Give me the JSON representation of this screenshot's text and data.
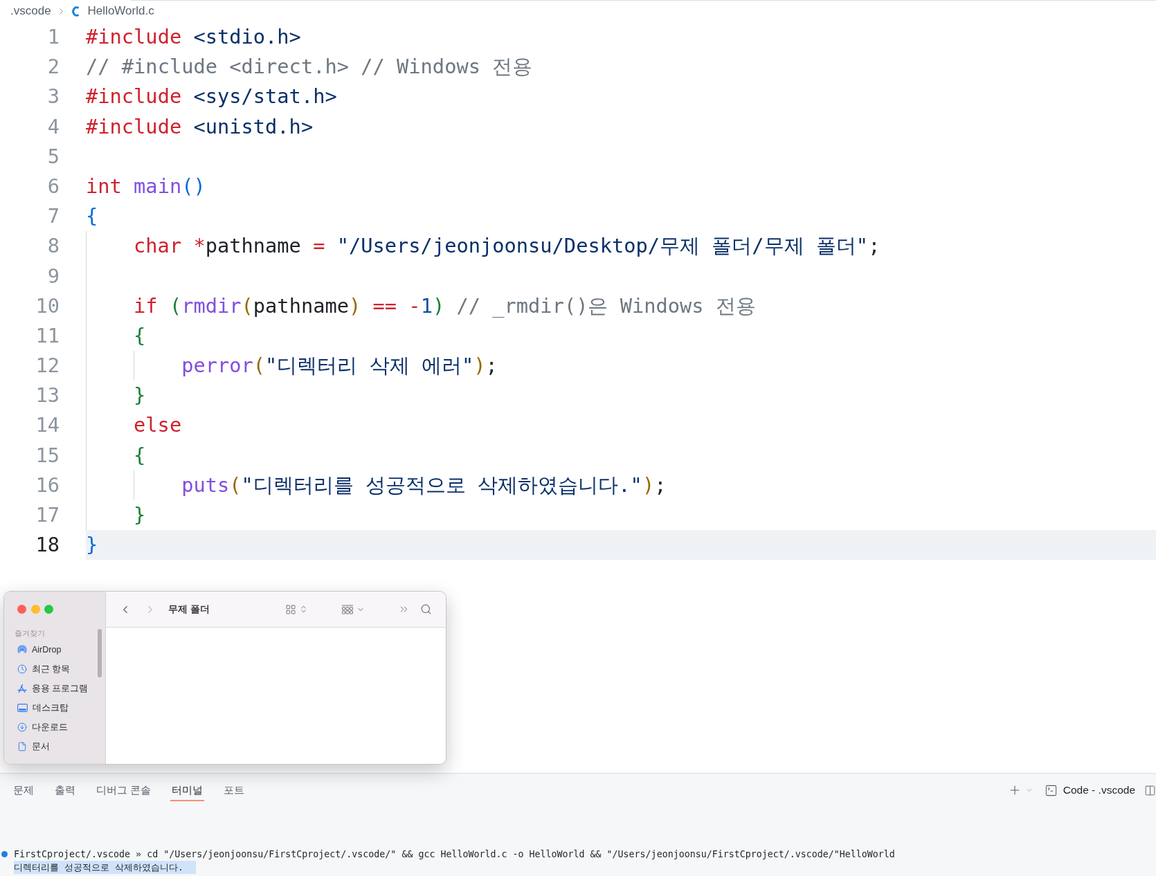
{
  "breadcrumb": [
    {
      "label": ".vscode",
      "kind": "folder"
    },
    {
      "label": "HelloWorld.c",
      "kind": "c_file"
    }
  ],
  "code": {
    "lines": [
      {
        "number": "1",
        "active": false,
        "tokens": [
          {
            "text": "#include",
            "kind": "keyword"
          },
          {
            "text": " <stdio.h>",
            "kind": "string"
          }
        ]
      },
      {
        "number": "2",
        "active": false,
        "tokens": [
          {
            "text": "// #include <direct.h> // Windows 전용",
            "kind": "comment"
          }
        ]
      },
      {
        "number": "3",
        "active": false,
        "tokens": [
          {
            "text": "#include",
            "kind": "keyword"
          },
          {
            "text": " <sys/stat.h>",
            "kind": "string"
          }
        ]
      },
      {
        "number": "4",
        "active": false,
        "tokens": [
          {
            "text": "#include",
            "kind": "keyword"
          },
          {
            "text": " <unistd.h>",
            "kind": "string"
          }
        ]
      },
      {
        "number": "5",
        "active": false
      },
      {
        "number": "6",
        "active": false,
        "tokens": [
          {
            "text": "int",
            "kind": "keyword"
          },
          {
            "text": " main",
            "kind": "function"
          },
          {
            "text": "(",
            "kind": "bracket1"
          },
          {
            "text": ")",
            "kind": "bracket1"
          }
        ]
      },
      {
        "number": "7",
        "active": false,
        "tokens": [
          {
            "text": "{",
            "kind": "bracket1"
          }
        ],
        "children": [
          {
            "number": "8",
            "active": false,
            "tokens": [
              {
                "text": "char",
                "kind": "keyword"
              },
              {
                "text": " *",
                "kind": "operator"
              },
              {
                "text": "pathname",
                "kind": "plain"
              },
              {
                "text": " =",
                "kind": "operator"
              },
              {
                "text": " \"/Users/jeonjoonsu/Desktop/무제 폴더/무제 폴더\"",
                "kind": "string"
              },
              {
                "text": ";",
                "kind": "plain"
              }
            ]
          },
          {
            "number": "9",
            "active": false
          },
          {
            "number": "10",
            "active": false,
            "tokens": [
              {
                "text": "if",
                "kind": "keyword"
              },
              {
                "text": " (",
                "kind": "bracket2"
              },
              {
                "text": "rmdir",
                "kind": "function"
              },
              {
                "text": "(",
                "kind": "bracket3"
              },
              {
                "text": "pathname",
                "kind": "plain"
              },
              {
                "text": ")",
                "kind": "bracket3"
              },
              {
                "text": " ==",
                "kind": "operator"
              },
              {
                "text": " -",
                "kind": "operator"
              },
              {
                "text": "1",
                "kind": "number"
              },
              {
                "text": ")",
                "kind": "bracket2"
              },
              {
                "text": " // _rmdir()은 Windows 전용",
                "kind": "comment"
              }
            ]
          },
          {
            "number": "11",
            "active": false,
            "tokens": [
              {
                "text": "{",
                "kind": "bracket2"
              }
            ],
            "children": [
              {
                "number": "12",
                "active": false,
                "tokens": [
                  {
                    "text": "perror",
                    "kind": "function"
                  },
                  {
                    "text": "(",
                    "kind": "bracket3"
                  },
                  {
                    "text": "\"디렉터리 삭제 에러\"",
                    "kind": "string"
                  },
                  {
                    "text": ")",
                    "kind": "bracket3"
                  },
                  {
                    "text": ";",
                    "kind": "plain"
                  }
                ]
              }
            ]
          },
          {
            "number": "13",
            "active": false,
            "tokens": [
              {
                "text": "}",
                "kind": "bracket2"
              }
            ]
          },
          {
            "number": "14",
            "active": false,
            "tokens": [
              {
                "text": "else",
                "kind": "keyword"
              }
            ]
          },
          {
            "number": "15",
            "active": false,
            "tokens": [
              {
                "text": "{",
                "kind": "bracket2"
              }
            ],
            "children": [
              {
                "number": "16",
                "active": false,
                "tokens": [
                  {
                    "text": "puts",
                    "kind": "function"
                  },
                  {
                    "text": "(",
                    "kind": "bracket3"
                  },
                  {
                    "text": "\"디렉터리를 성공적으로 삭제하였습니다.\"",
                    "kind": "string"
                  },
                  {
                    "text": ")",
                    "kind": "bracket3"
                  },
                  {
                    "text": ";",
                    "kind": "plain"
                  }
                ]
              }
            ]
          },
          {
            "number": "17",
            "active": false,
            "tokens": [
              {
                "text": "}",
                "kind": "bracket2"
              }
            ]
          }
        ]
      },
      {
        "number": "18",
        "active": true,
        "tokens": [
          {
            "text": "}",
            "kind": "bracket1"
          }
        ]
      }
    ]
  },
  "finder": {
    "title": "무제 폴더",
    "nav": [
      {
        "kind": "back",
        "disabled": false
      },
      {
        "kind": "forward",
        "disabled": true
      }
    ],
    "sidebar": {
      "section": "즐겨찾기",
      "items": [
        {
          "label": "AirDrop",
          "kind": "airdrop",
          "selected": false
        },
        {
          "label": "최근 항목",
          "kind": "recent",
          "selected": false
        },
        {
          "label": "응용 프로그램",
          "kind": "applications",
          "selected": false
        },
        {
          "label": "데스크탑",
          "kind": "desktop",
          "selected": false
        },
        {
          "label": "다운로드",
          "kind": "downloads",
          "selected": false
        },
        {
          "label": "문서",
          "kind": "documents",
          "selected": false
        }
      ]
    }
  },
  "panel": {
    "tabs": [
      {
        "label": "문제",
        "selected": false
      },
      {
        "label": "출력",
        "selected": false
      },
      {
        "label": "디버그 콘솔",
        "selected": false
      },
      {
        "label": "터미널",
        "selected": true
      },
      {
        "label": "포트",
        "selected": false
      }
    ],
    "terminal_name": "Code - .vscode",
    "terminal_lines": [
      {
        "kind": "command",
        "text": "FirstCproject/.vscode » cd \"/Users/jeonjoonsu/FirstCproject/.vscode/\" && gcc HelloWorld.c -o HelloWorld && \"/Users/jeonjoonsu/FirstCproject/.vscode/\"HelloWorld",
        "highlighted": false
      },
      {
        "kind": "output",
        "text": "디렉터리를 성공적으로 삭제하였습니다.",
        "highlighted": true
      }
    ]
  }
}
